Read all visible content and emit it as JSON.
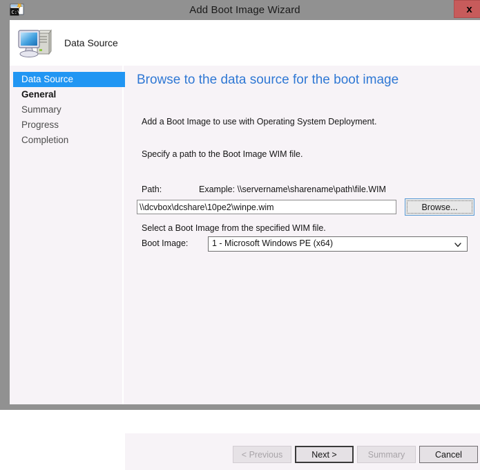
{
  "window": {
    "title": "Add Boot Image Wizard",
    "icon": "sccm-console-icon",
    "close_label": "x"
  },
  "banner": {
    "icon": "computer-icon",
    "title": "Data Source"
  },
  "sidebar": {
    "items": [
      {
        "label": "Data Source",
        "state": "current"
      },
      {
        "label": "General",
        "state": "done"
      },
      {
        "label": "Summary",
        "state": "pending"
      },
      {
        "label": "Progress",
        "state": "pending"
      },
      {
        "label": "Completion",
        "state": "pending"
      }
    ]
  },
  "content": {
    "heading": "Browse to the data source for the boot image",
    "intro_line_1": "Add a Boot Image to use with Operating System Deployment.",
    "intro_line_2": "Specify a path to the Boot Image WIM file.",
    "path_label": "Path:",
    "path_example": "Example: \\\\servername\\sharename\\path\\file.WIM",
    "path_value": "\\\\dcvbox\\dcshare\\10pe2\\winpe.wim",
    "path_placeholder": "",
    "browse_label": "Browse...",
    "select_hint": "Select a Boot Image from the specified WIM file.",
    "bootimage_label": "Boot Image:",
    "bootimage_value": "1 - Microsoft Windows PE (x64)",
    "bootimage_options": [
      "1 - Microsoft Windows PE (x64)"
    ]
  },
  "footer": {
    "previous_label": "< Previous",
    "next_label": "Next >",
    "summary_label": "Summary",
    "cancel_label": "Cancel"
  },
  "colors": {
    "titlebar": "#919191",
    "close_button": "#c75b5b",
    "accent_heading": "#2f78d4",
    "selection": "#2196f3",
    "content_background": "#f7f3f7"
  }
}
